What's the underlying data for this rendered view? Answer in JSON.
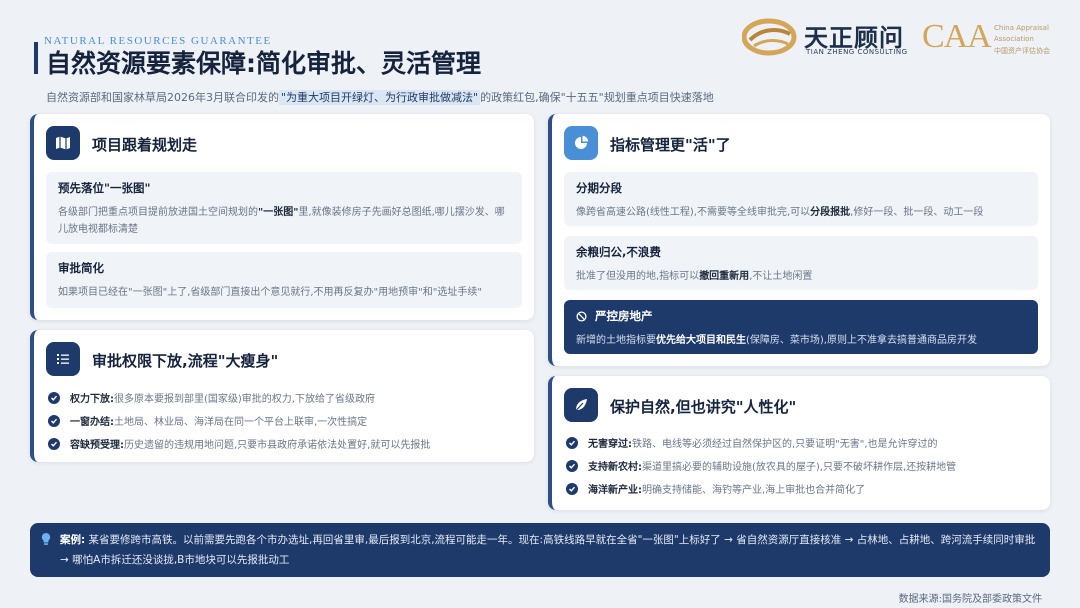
{
  "header": {
    "kicker": "NATURAL RESOURCES GUARANTEE",
    "title": "自然资源要素保障:简化审批、灵活管理",
    "subline_pre": "自然资源部和国家林草局2026年3月联合印发的",
    "subline_hl": "\"为重大项目开绿灯、为行政审批做减法\"",
    "subline_post": "的政策红包,确保\"十五五\"规划重点项目快速落地"
  },
  "logos": {
    "tz_cn": "天正顾问",
    "tz_en": "TIAN ZHENG CONSULTING",
    "caa": "CAA",
    "caa_line1": "China Appraisal",
    "caa_line2": "Association",
    "caa_line3": "中国资产评估协会"
  },
  "cards": {
    "plan": {
      "title": "项目跟着规划走",
      "icon": "map-icon",
      "items": [
        {
          "heading": "预先落位\"一张图\"",
          "text_a": "各级部门把重点项目提前放进国土空间规划的",
          "text_b": "\"一张图\"",
          "text_c": "里,就像装修房子先画好总图纸,哪儿摆沙发、哪儿放电视都标清楚"
        },
        {
          "heading": "审批简化",
          "text_a": "如果项目已经在\"一张图\"上了,省级部门直接出个意见就行,不用再反复办\"用地预审\"和\"选址手续\"",
          "text_b": "",
          "text_c": ""
        }
      ]
    },
    "authority": {
      "title": "审批权限下放,流程\"大瘦身\"",
      "icon": "list-icon",
      "items": [
        {
          "key": "权力下放:",
          "text": "很多原本要报到部里(国家级)审批的权力,下放给了省级政府"
        },
        {
          "key": "一窗办结:",
          "text": "土地局、林业局、海洋局在同一个平台上联审,一次性搞定"
        },
        {
          "key": "容缺预受理:",
          "text": "历史遗留的违规用地问题,只要市县政府承诺依法处置好,就可以先报批"
        }
      ]
    },
    "quota": {
      "title": "指标管理更\"活\"了",
      "icon": "pie-chart-icon",
      "items": [
        {
          "heading": "分期分段",
          "text_a": "像跨省高速公路(线性工程),不需要等全线审批完,可以",
          "text_b": "分段报批",
          "text_c": ",修好一段、批一段、动工一段"
        },
        {
          "heading": "余粮归公,不浪费",
          "text_a": "批准了但没用的地,指标可以",
          "text_b": "撤回重新用",
          "text_c": ",不让土地闲置"
        }
      ],
      "strict": {
        "heading": "严控房地产",
        "text_a": "新增的土地指标要",
        "text_b": "优先给大项目和民生",
        "text_c": "(保障房、菜市场),原则上不准拿去搞普通商品房开发"
      }
    },
    "nature": {
      "title": "保护自然,但也讲究\"人性化\"",
      "icon": "leaf-icon",
      "items": [
        {
          "key": "无害穿过:",
          "text": "铁路、电线等必须经过自然保护区的,只要证明\"无害\",也是允许穿过的"
        },
        {
          "key": "支持新农村:",
          "text": "渠道里搞必要的辅助设施(放农具的屋子),只要不破坏耕作层,还按耕地管"
        },
        {
          "key": "海洋新产业:",
          "text": "明确支持储能、海钓等产业,海上审批也合并简化了"
        }
      ]
    }
  },
  "case": {
    "label": "案例:",
    "text": "某省要修跨市高铁。以前需要先跑各个市办选址,再回省里审,最后报到北京,流程可能走一年。现在:高铁线路早就在全省\"一张图\"上标好了 → 省自然资源厅直接核准 → 占林地、占耕地、跨河流手续同时审批 → 哪怕A市拆迁还没谈拢,B市地块可以先报批动工"
  },
  "source": "数据来源:国务院及部委政策文件",
  "colors": {
    "navy": "#1e3a6a",
    "accent": "#4a8fd6",
    "gold": "#d4a65a",
    "background": "#eef1f5"
  }
}
